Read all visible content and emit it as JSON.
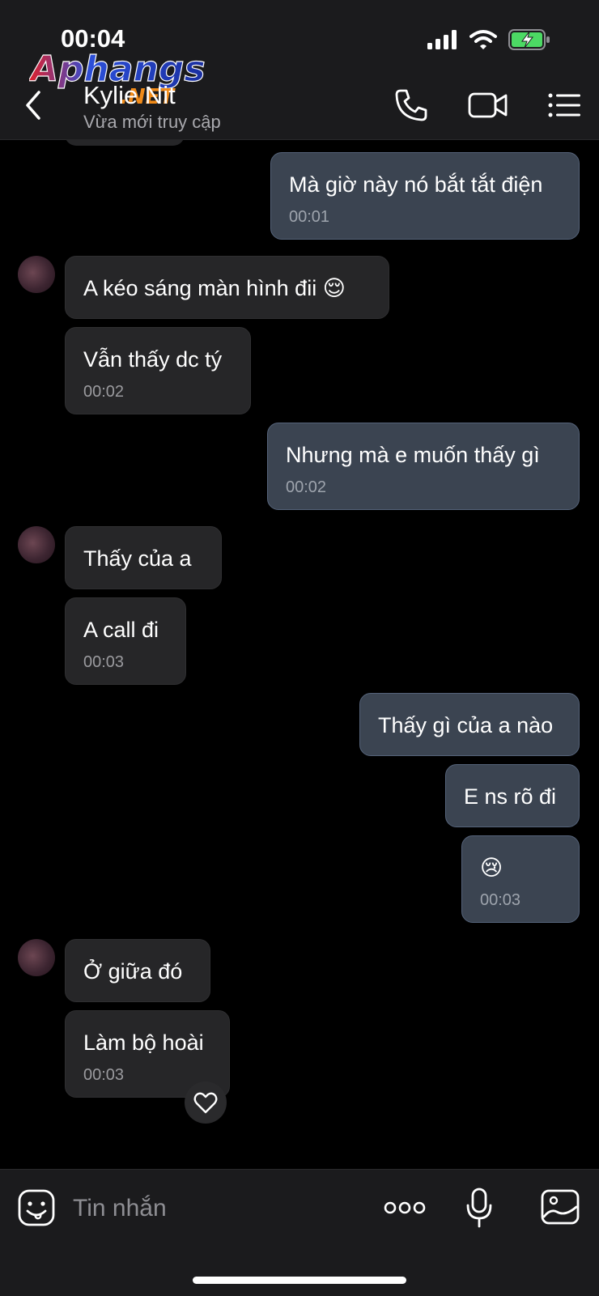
{
  "status_bar": {
    "time": "00:04"
  },
  "watermark": {
    "text_main": "Aphangs",
    "text_suffix": ".NET"
  },
  "header": {
    "contact_name": "Kylie Nit",
    "contact_status": "Vừa mới truy cập"
  },
  "messages": [
    {
      "side": "out",
      "text": "Mà giờ này nó bắt tắt điện",
      "time": "00:01"
    },
    {
      "side": "in",
      "text": "A kéo sáng màn hình đii 😌",
      "time": ""
    },
    {
      "side": "in",
      "text": "Vẫn thấy dc tý",
      "time": "00:02"
    },
    {
      "side": "out",
      "text": "Nhưng mà e muốn thấy gì",
      "time": "00:02"
    },
    {
      "side": "in",
      "text": "Thấy của a",
      "time": ""
    },
    {
      "side": "in",
      "text": "A call đi",
      "time": "00:03"
    },
    {
      "side": "out",
      "text": "Thấy gì của a nào",
      "time": ""
    },
    {
      "side": "out",
      "text": "E ns rõ đi",
      "time": ""
    },
    {
      "side": "out",
      "text": "😢",
      "time": "00:03"
    },
    {
      "side": "in",
      "text": "Ở giữa đó",
      "time": ""
    },
    {
      "side": "in",
      "text": "Làm bộ hoài",
      "time": "00:03"
    }
  ],
  "input": {
    "placeholder": "Tin nhắn"
  },
  "icons": {
    "back": "chevron-left-icon",
    "call": "phone-icon",
    "video": "video-camera-icon",
    "menu": "list-icon",
    "sticker": "sticker-face-icon",
    "more": "more-dots-icon",
    "mic": "microphone-icon",
    "image": "image-icon",
    "react": "heart-icon"
  },
  "colors": {
    "outgoing_bubble": "#3b4451",
    "incoming_bubble": "#262628",
    "battery_charging": "#4cd964"
  }
}
